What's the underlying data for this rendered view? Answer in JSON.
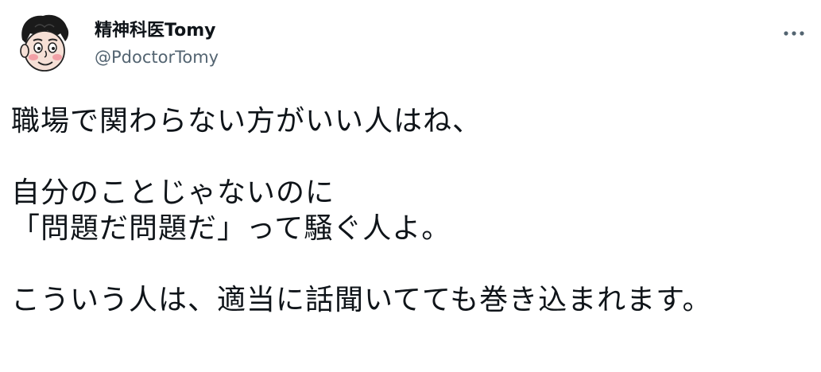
{
  "author": {
    "display_name": "精神科医Tomy",
    "handle": "@PdoctorTomy",
    "avatar_icon": "cartoon-face-avatar"
  },
  "actions": {
    "more_icon": "more-horizontal-icon"
  },
  "tweet": {
    "lines": [
      "職場で関わらない方がいい人はね、",
      "",
      "自分のことじゃないのに",
      "「問題だ問題だ」って騒ぐ人よ。",
      "",
      "こういう人は、適当に話聞いてても巻き込まれます。"
    ]
  },
  "colors": {
    "text": "#0f1419",
    "secondary": "#536471"
  }
}
